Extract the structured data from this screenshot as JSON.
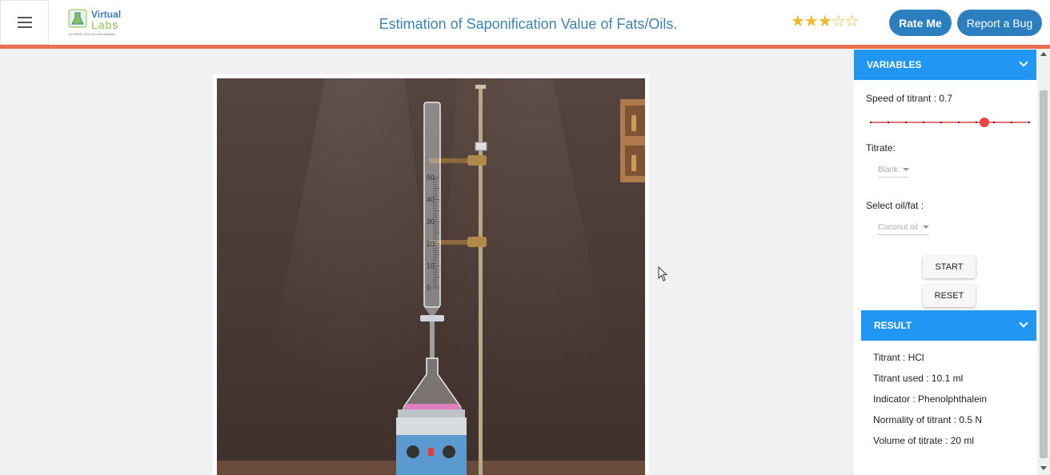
{
  "header": {
    "logo_line1": "Virtual",
    "logo_line2": "Labs",
    "logo_tagline": "An MHRD Govt of India Initiative",
    "title": "Estimation of Saponification Value of Fats/Oils.",
    "rating_stars": "★★★☆☆",
    "rating_value": 3,
    "rating_max": 5,
    "rate_button": "Rate Me",
    "bug_button": "Report a Bug"
  },
  "simulation": {
    "burette_marks": [
      "50",
      "40",
      "30",
      "20",
      "10",
      "0"
    ]
  },
  "variables": {
    "header": "VARIABLES",
    "speed_label": "Speed of titrant : 0.7",
    "speed_value": 0.7,
    "titrate_label": "Titrate:",
    "titrate_selected": "Blank",
    "oil_label": "Select oil/fat :",
    "oil_selected": "Coconut oil",
    "start_button": "START",
    "reset_button": "RESET"
  },
  "result": {
    "header": "RESULT",
    "lines": [
      "Titrant : HCl",
      "Titrant used : 10.1 ml",
      "Indicator : Phenolphthalein",
      "Normality of titrant : 0.5 N",
      "Volume of titrate : 20 ml"
    ]
  },
  "colors": {
    "accent_bar": "#e96f4f",
    "primary": "#2b7fbf",
    "panel_header": "#2196f3",
    "star": "#f0b928"
  }
}
